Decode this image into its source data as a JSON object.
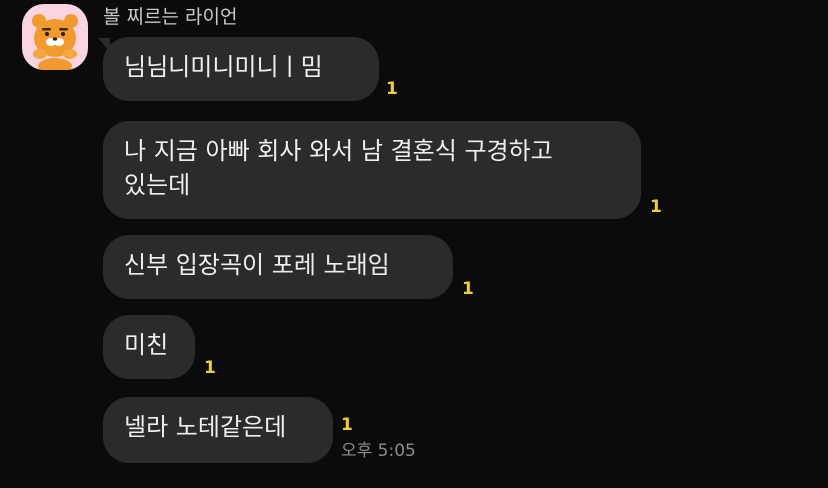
{
  "chat": {
    "sender_name": "볼 찌르는 라이언",
    "avatar_icon": "ryan-lion-avatar-icon",
    "bubble_color": "#2b2b2d",
    "unread_color": "#f2cf2e",
    "messages": [
      {
        "text": "님님니미니미니ㅣ밈",
        "unread": "1"
      },
      {
        "line1": "나 지금 아빠 회사 와서 남 결혼식 구경하고",
        "line2": "있는데",
        "unread": "1"
      },
      {
        "text": "신부 입장곡이 포레 노래임",
        "unread": "1"
      },
      {
        "text": "미친",
        "unread": "1"
      },
      {
        "text": "넬라 노테같은데",
        "unread": "1",
        "time": "오후 5:05"
      }
    ]
  }
}
